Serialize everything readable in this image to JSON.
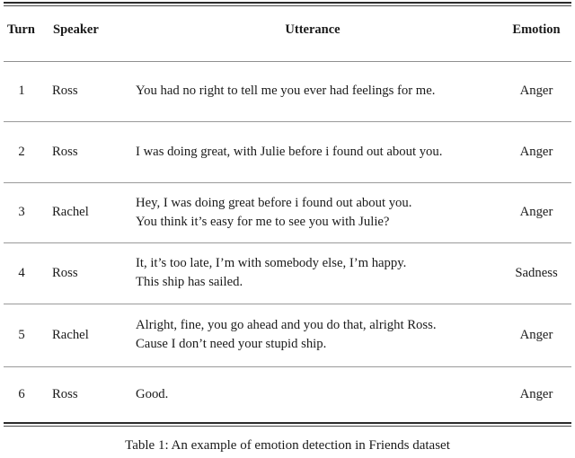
{
  "table": {
    "columns": [
      {
        "key": "turn",
        "label": "Turn"
      },
      {
        "key": "speaker",
        "label": "Speaker"
      },
      {
        "key": "utterance",
        "label": "Utterance"
      },
      {
        "key": "emotion",
        "label": "Emotion"
      }
    ],
    "rows": [
      {
        "turn": "1",
        "speaker": "Ross",
        "utterance_lines": [
          "You had no right to tell me you ever had feelings for me."
        ],
        "emotion": "Anger"
      },
      {
        "turn": "2",
        "speaker": "Ross",
        "utterance_lines": [
          "I was doing great, with Julie before i found out about you."
        ],
        "emotion": "Anger"
      },
      {
        "turn": "3",
        "speaker": "Rachel",
        "utterance_lines": [
          "Hey, I was doing great before i found out about you.",
          "You think it’s easy for me to see you with Julie?"
        ],
        "emotion": "Anger"
      },
      {
        "turn": "4",
        "speaker": "Ross",
        "utterance_lines": [
          "It, it’s too late, I’m with somebody else, I’m happy.",
          "This ship has sailed."
        ],
        "emotion": "Sadness"
      },
      {
        "turn": "5",
        "speaker": "Rachel",
        "utterance_lines": [
          "Alright, fine, you go ahead and you do that, alright Ross.",
          "Cause I don’t need your stupid ship."
        ],
        "emotion": "Anger"
      },
      {
        "turn": "6",
        "speaker": "Ross",
        "utterance_lines": [
          "Good."
        ],
        "emotion": "Anger"
      }
    ]
  },
  "caption": {
    "label": "Table 1:",
    "text": "An example of emotion detection in Friends dataset",
    "full": "Table 1: An example of emotion detection in Friends dataset"
  },
  "colors": {
    "text": "#1a1a1a",
    "rule_heavy": "#2b2b2b",
    "rule_light": "#9a9a9a",
    "background": "#ffffff"
  }
}
